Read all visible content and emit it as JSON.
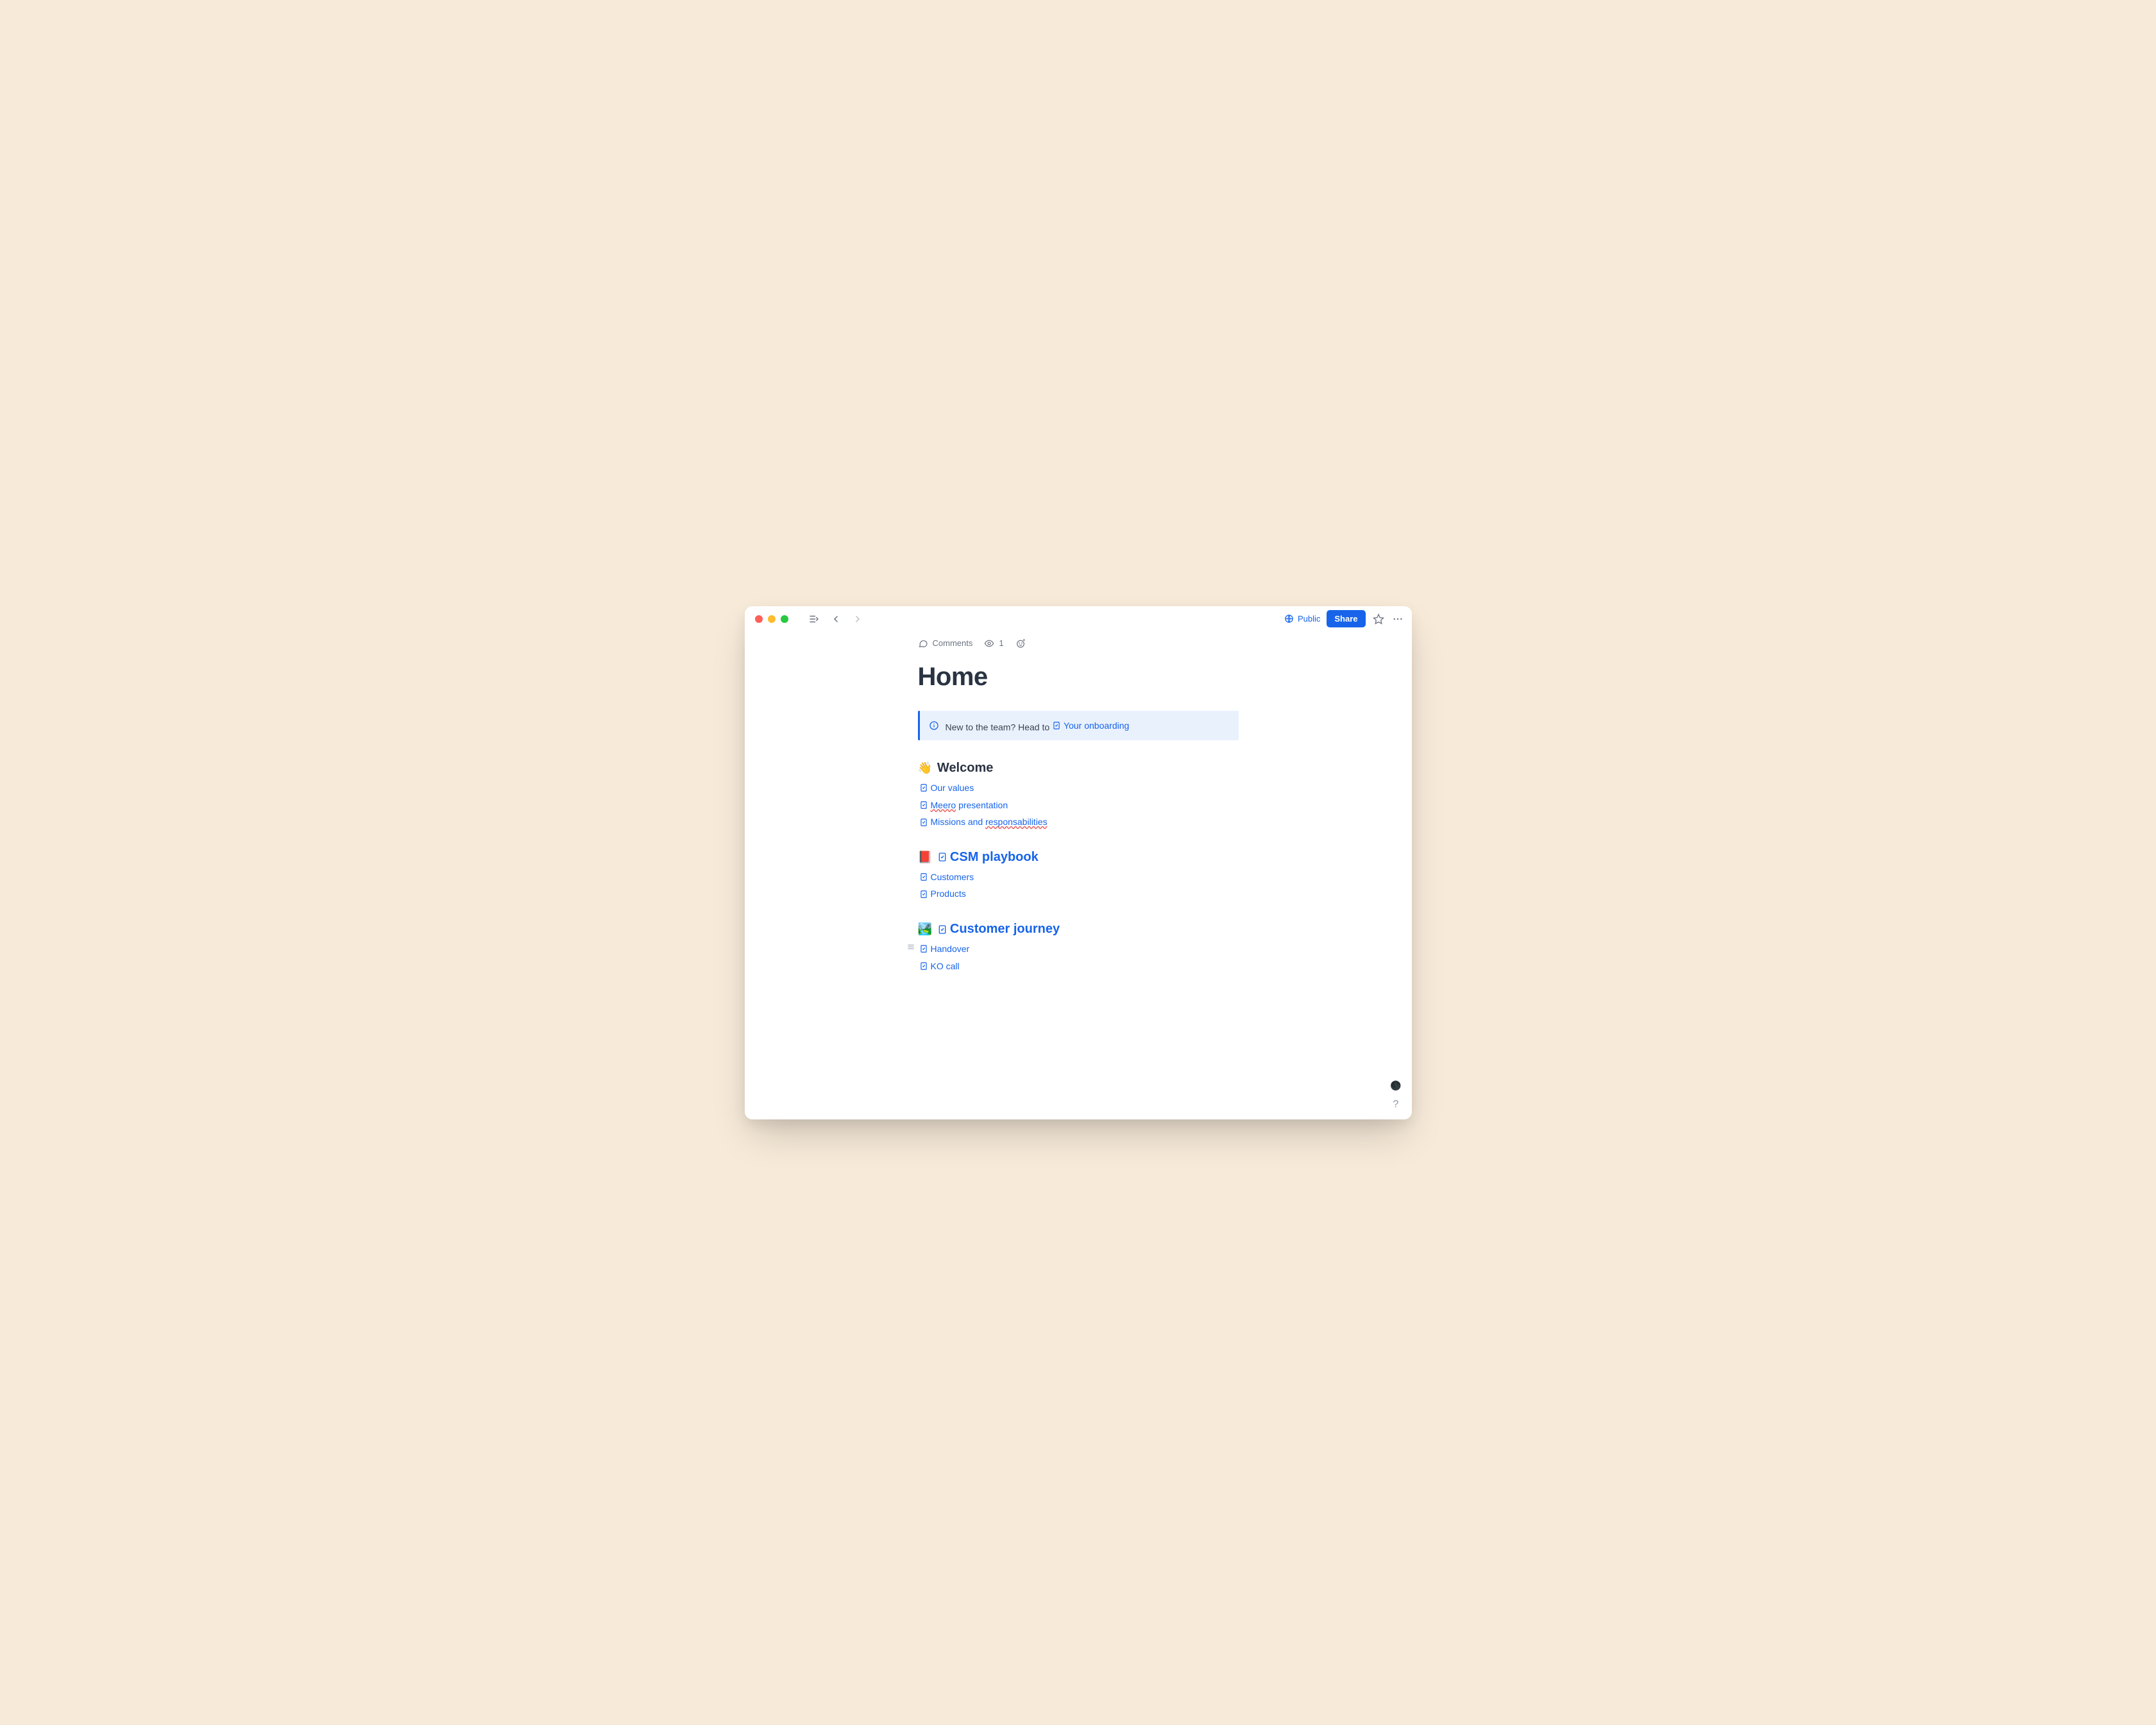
{
  "titlebar": {
    "public_label": "Public",
    "share_label": "Share"
  },
  "meta": {
    "comments_label": "Comments",
    "view_count": "1"
  },
  "page": {
    "title": "Home"
  },
  "callout": {
    "text_before": "New to the team? Head to ",
    "link_label": "Your onboarding"
  },
  "sections": {
    "welcome": {
      "emoji": "👋",
      "title": "Welcome",
      "links": {
        "our_values": "Our values",
        "meero_pre": "Meero",
        "meero_post": " presentation",
        "missions_pre": "Missions and ",
        "missions_spell": "responsabilities"
      }
    },
    "playbook": {
      "emoji": "📕",
      "title": "CSM playbook",
      "customers": "Customers",
      "products": "Products"
    },
    "journey": {
      "emoji": "🏞️",
      "title": "Customer journey",
      "handover": "Handover",
      "ko_call": "KO call"
    }
  },
  "floaters": {
    "help_label": "?"
  }
}
